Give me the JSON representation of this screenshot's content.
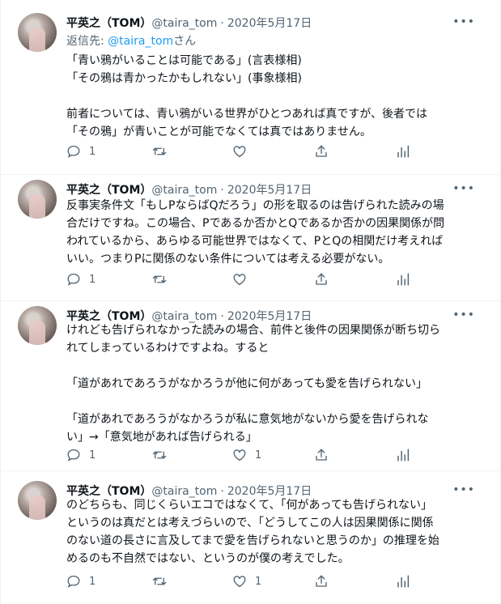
{
  "tweets": [
    {
      "author": {
        "name": "平英之（TOM）",
        "handle": "@taira_tom"
      },
      "dot": "·",
      "date": "2020年5月17日",
      "reply_to": {
        "prefix": "返信先: ",
        "mention": "@taira_tom",
        "suffix": "さん"
      },
      "lines": [
        "「青い鴉がいることは可能である」(言表様相)",
        "「その鴉は青かったかもしれない」(事象様相)",
        "",
        "前者については、青い鴉がいる世界がひとつあれば真ですが、後者では",
        "「その鴉」が青いことが可能でなくては真ではありません。"
      ],
      "reply_count": "1",
      "retweet_count": "",
      "like_count": ""
    },
    {
      "author": {
        "name": "平英之（TOM）",
        "handle": "@taira_tom"
      },
      "dot": "·",
      "date": "2020年5月17日",
      "lines": [
        "反事実条件文「もしPならばQだろう」の形を取るのは告げられた読みの場",
        "合だけですね。この場合、Pであるか否かとQであるか否かの因果関係が問",
        "われているから、あらゆる可能世界ではなくて、PとQの相関だけ考えれば",
        "いい。つまりPに関係のない条件については考える必要がない。"
      ],
      "reply_count": "1",
      "retweet_count": "",
      "like_count": ""
    },
    {
      "author": {
        "name": "平英之（TOM）",
        "handle": "@taira_tom"
      },
      "dot": "·",
      "date": "2020年5月17日",
      "lines": [
        "けれども告げられなかった読みの場合、前件と後件の因果関係が断ち切ら",
        "れてしまっているわけですよね。すると",
        "",
        "「道があれであろうがなかろうが他に何があっても愛を告げられない」",
        "",
        "「道があれであろうがなかろうが私に意気地がないから愛を告げられな",
        "い」→「意気地があれば告げられる」"
      ],
      "reply_count": "1",
      "retweet_count": "",
      "like_count": "1"
    },
    {
      "author": {
        "name": "平英之（TOM）",
        "handle": "@taira_tom"
      },
      "dot": "·",
      "date": "2020年5月17日",
      "lines": [
        "のどちらも、同じくらいエコではなくて、「何があっても告げられない」",
        "というのは真だとは考えづらいので、「どうしてこの人は因果関係に関係",
        "のない道の長さに言及してまで愛を告げられないと思うのか」の推理を始",
        "めるのも不自然ではない、というのが僕の考えでした。"
      ],
      "reply_count": "1",
      "retweet_count": "",
      "like_count": "1"
    }
  ],
  "icons": {
    "reply": "reply-icon",
    "retweet": "retweet-icon",
    "like": "heart-icon",
    "share": "share-icon",
    "analytics": "analytics-icon",
    "more": "more-icon"
  },
  "colors": {
    "text": "#0f1419",
    "secondary": "#536471",
    "link": "#1d9bf0",
    "border": "#eff3f4"
  }
}
